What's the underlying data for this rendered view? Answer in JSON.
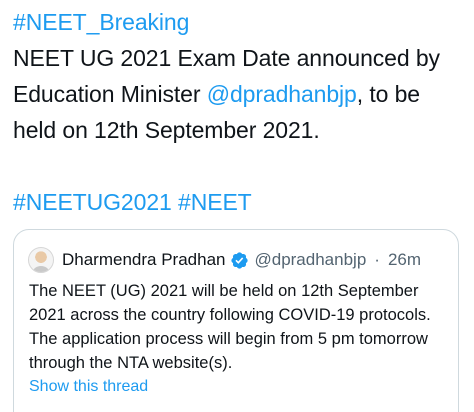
{
  "tweet": {
    "lines": [
      "#NEET_Breaking",
      "NEET UG 2021 Exam Date announced by",
      "Education Minister ",
      "held on 12th September 2021."
    ],
    "mention": "@dpradhanbjp",
    "line3_suffix": ", to be",
    "hashtags": [
      "#NEETUG2021",
      "#NEET"
    ]
  },
  "quote": {
    "author_name": "Dharmendra Pradhan",
    "handle": "@dpradhanbjp",
    "separator": "·",
    "time": "26m",
    "text_lines": [
      "The NEET (UG) 2021 will be held on 12th September",
      "2021 across the country following COVID-19 protocols.",
      "The application process will begin from 5 pm tomorrow",
      "through the NTA website(s)."
    ],
    "show_thread": "Show this thread"
  },
  "colors": {
    "link": "#1d9bf0",
    "text": "#0f1419",
    "muted": "#536471",
    "border": "#cfd9de"
  },
  "icons": {
    "verified": "verified-badge-icon",
    "avatar": "avatar"
  }
}
